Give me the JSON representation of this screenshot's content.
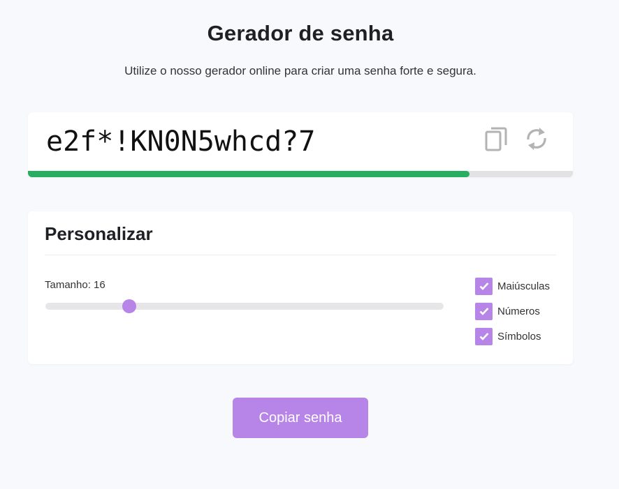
{
  "header": {
    "title": "Gerador de senha",
    "subtitle": "Utilize o nosso gerador online para criar uma senha forte e segura."
  },
  "password": {
    "value": "e2f*!KN0N5whcd?7",
    "strength_fraction": 0.81,
    "strength_color": "#27ae60",
    "copy_icon": "copy-icon",
    "refresh_icon": "refresh-icon"
  },
  "customize": {
    "title": "Personalizar",
    "length_label": "Tamanho: 16",
    "length_value": 16,
    "length_slider_fraction": 0.21,
    "options": [
      {
        "label": "Maiúsculas",
        "checked": true
      },
      {
        "label": "Números",
        "checked": true
      },
      {
        "label": "Símbolos",
        "checked": true
      }
    ]
  },
  "actions": {
    "copy_label": "Copiar senha"
  },
  "colors": {
    "accent": "#b784e8",
    "strength": "#27ae60",
    "background": "#f8f9fc"
  }
}
